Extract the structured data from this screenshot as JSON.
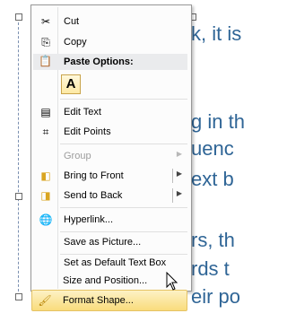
{
  "background_text": [
    "k, it is",
    "g in th",
    "uenc",
    "ext b",
    "rs, th",
    "rds t",
    "eir po"
  ],
  "menu": {
    "cut": {
      "label": "Cut",
      "icon": "scissors-icon"
    },
    "copy": {
      "label": "Copy",
      "icon": "copy-icon"
    },
    "paste_options": {
      "label": "Paste Options:",
      "icon": "clipboard-icon"
    },
    "paste_keep_text": {
      "label": "A"
    },
    "edit_text": {
      "label": "Edit Text",
      "icon": "edit-text-icon"
    },
    "edit_points": {
      "label": "Edit Points",
      "icon": "edit-points-icon"
    },
    "group": {
      "label": "Group",
      "disabled": true
    },
    "bring_to_front": {
      "label": "Bring to Front",
      "icon": "bring-to-front-icon"
    },
    "send_to_back": {
      "label": "Send to Back",
      "icon": "send-to-back-icon"
    },
    "hyperlink": {
      "label": "Hyperlink...",
      "icon": "globe-link-icon"
    },
    "save_as_picture": {
      "label": "Save as Picture..."
    },
    "set_default": {
      "label": "Set as Default Text Box"
    },
    "size_position": {
      "label": "Size and Position..."
    },
    "format_shape": {
      "label": "Format Shape...",
      "icon": "paint-brush-icon",
      "highlighted": true
    }
  },
  "colors": {
    "highlight": "#f9dc7c",
    "doc_text": "#2f6596"
  }
}
